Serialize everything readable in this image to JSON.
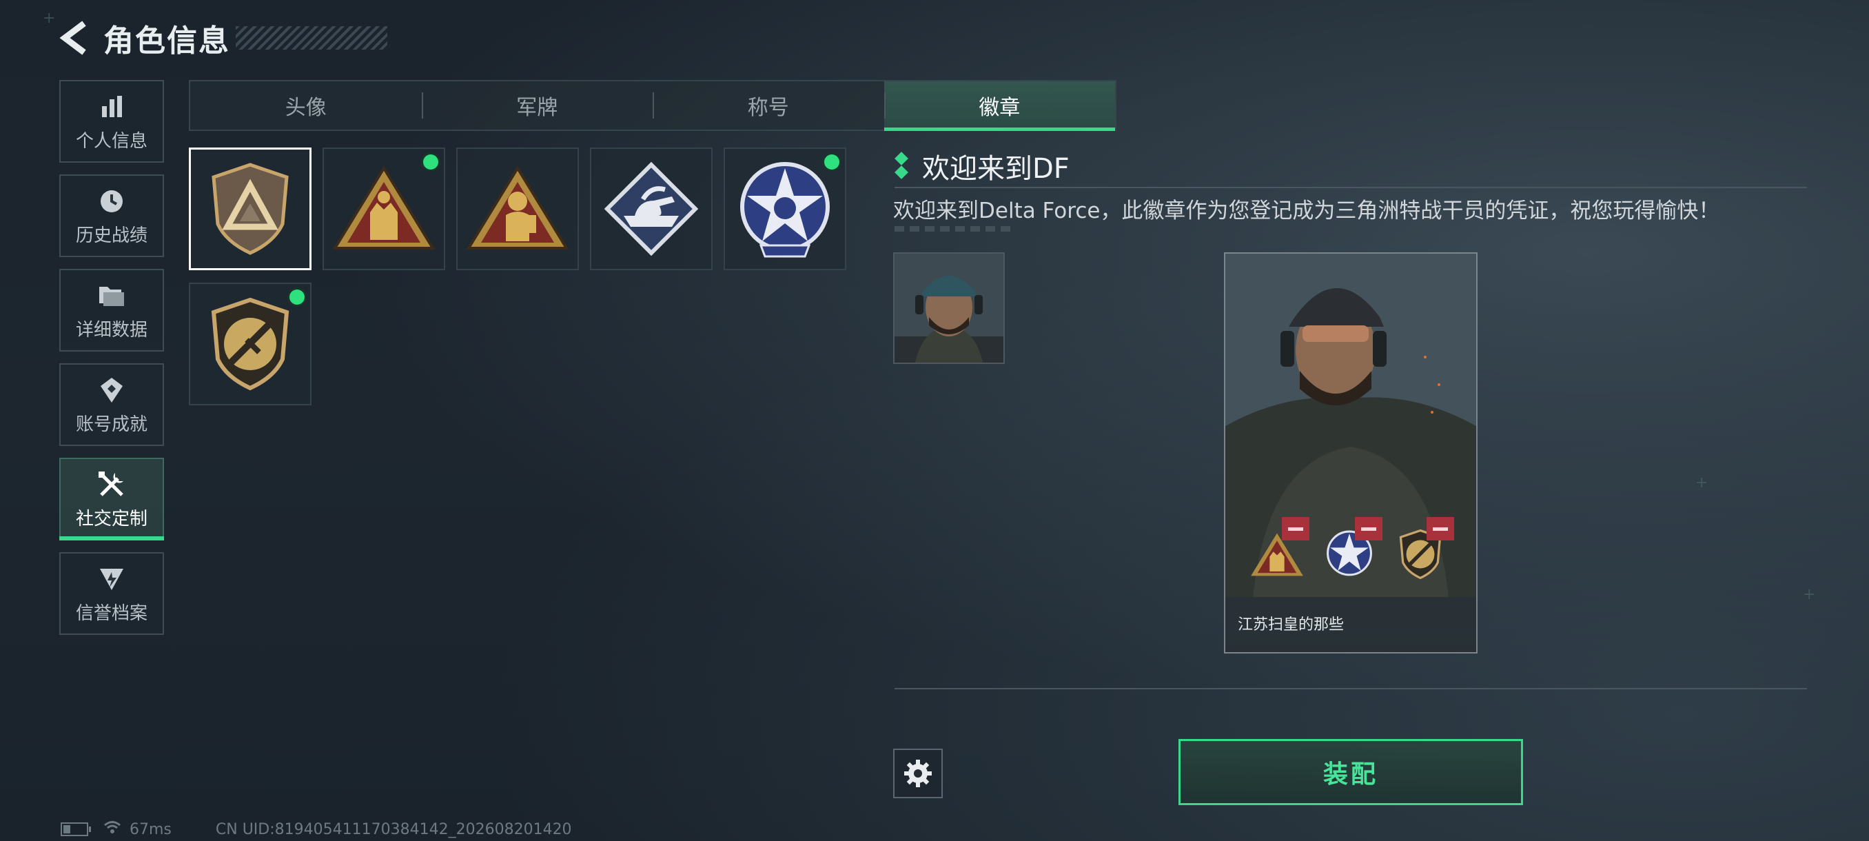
{
  "header": {
    "title": "角色信息"
  },
  "sidebar": {
    "items": [
      {
        "label": "个人信息",
        "icon": "bar-chart-icon"
      },
      {
        "label": "历史战绩",
        "icon": "clock-icon"
      },
      {
        "label": "详细数据",
        "icon": "folder-icon"
      },
      {
        "label": "账号成就",
        "icon": "achievement-icon"
      },
      {
        "label": "社交定制",
        "icon": "tools-icon",
        "active": true
      },
      {
        "label": "信誉档案",
        "icon": "shield-arrow-icon"
      }
    ]
  },
  "tabs": [
    {
      "label": "头像"
    },
    {
      "label": "军牌"
    },
    {
      "label": "称号"
    },
    {
      "label": "徽章",
      "active": true
    }
  ],
  "badges": [
    {
      "name": "delta-triangle-badge",
      "selected": true,
      "new": false
    },
    {
      "name": "soldiers-triangle-badge",
      "selected": false,
      "new": true
    },
    {
      "name": "diver-triangle-badge",
      "selected": false,
      "new": false
    },
    {
      "name": "tank-diamond-badge",
      "selected": false,
      "new": false
    },
    {
      "name": "star-skull-badge",
      "selected": false,
      "new": true
    },
    {
      "name": "knife-shield-badge",
      "selected": false,
      "new": true
    }
  ],
  "detail": {
    "title": "欢迎来到DF",
    "description": "欢迎来到Delta Force，此徽章作为您登记成为三角洲特战干员的凭证，祝您玩得愉快！"
  },
  "card": {
    "name": "江苏扫皇的那些"
  },
  "actions": {
    "equip_label": "装配"
  },
  "status": {
    "ping": "67ms",
    "uid": "CN UID:819405411170384142_202608201420"
  },
  "colors": {
    "accent": "#39d98c",
    "remove": "#a9313b",
    "background": "#1c252e"
  }
}
